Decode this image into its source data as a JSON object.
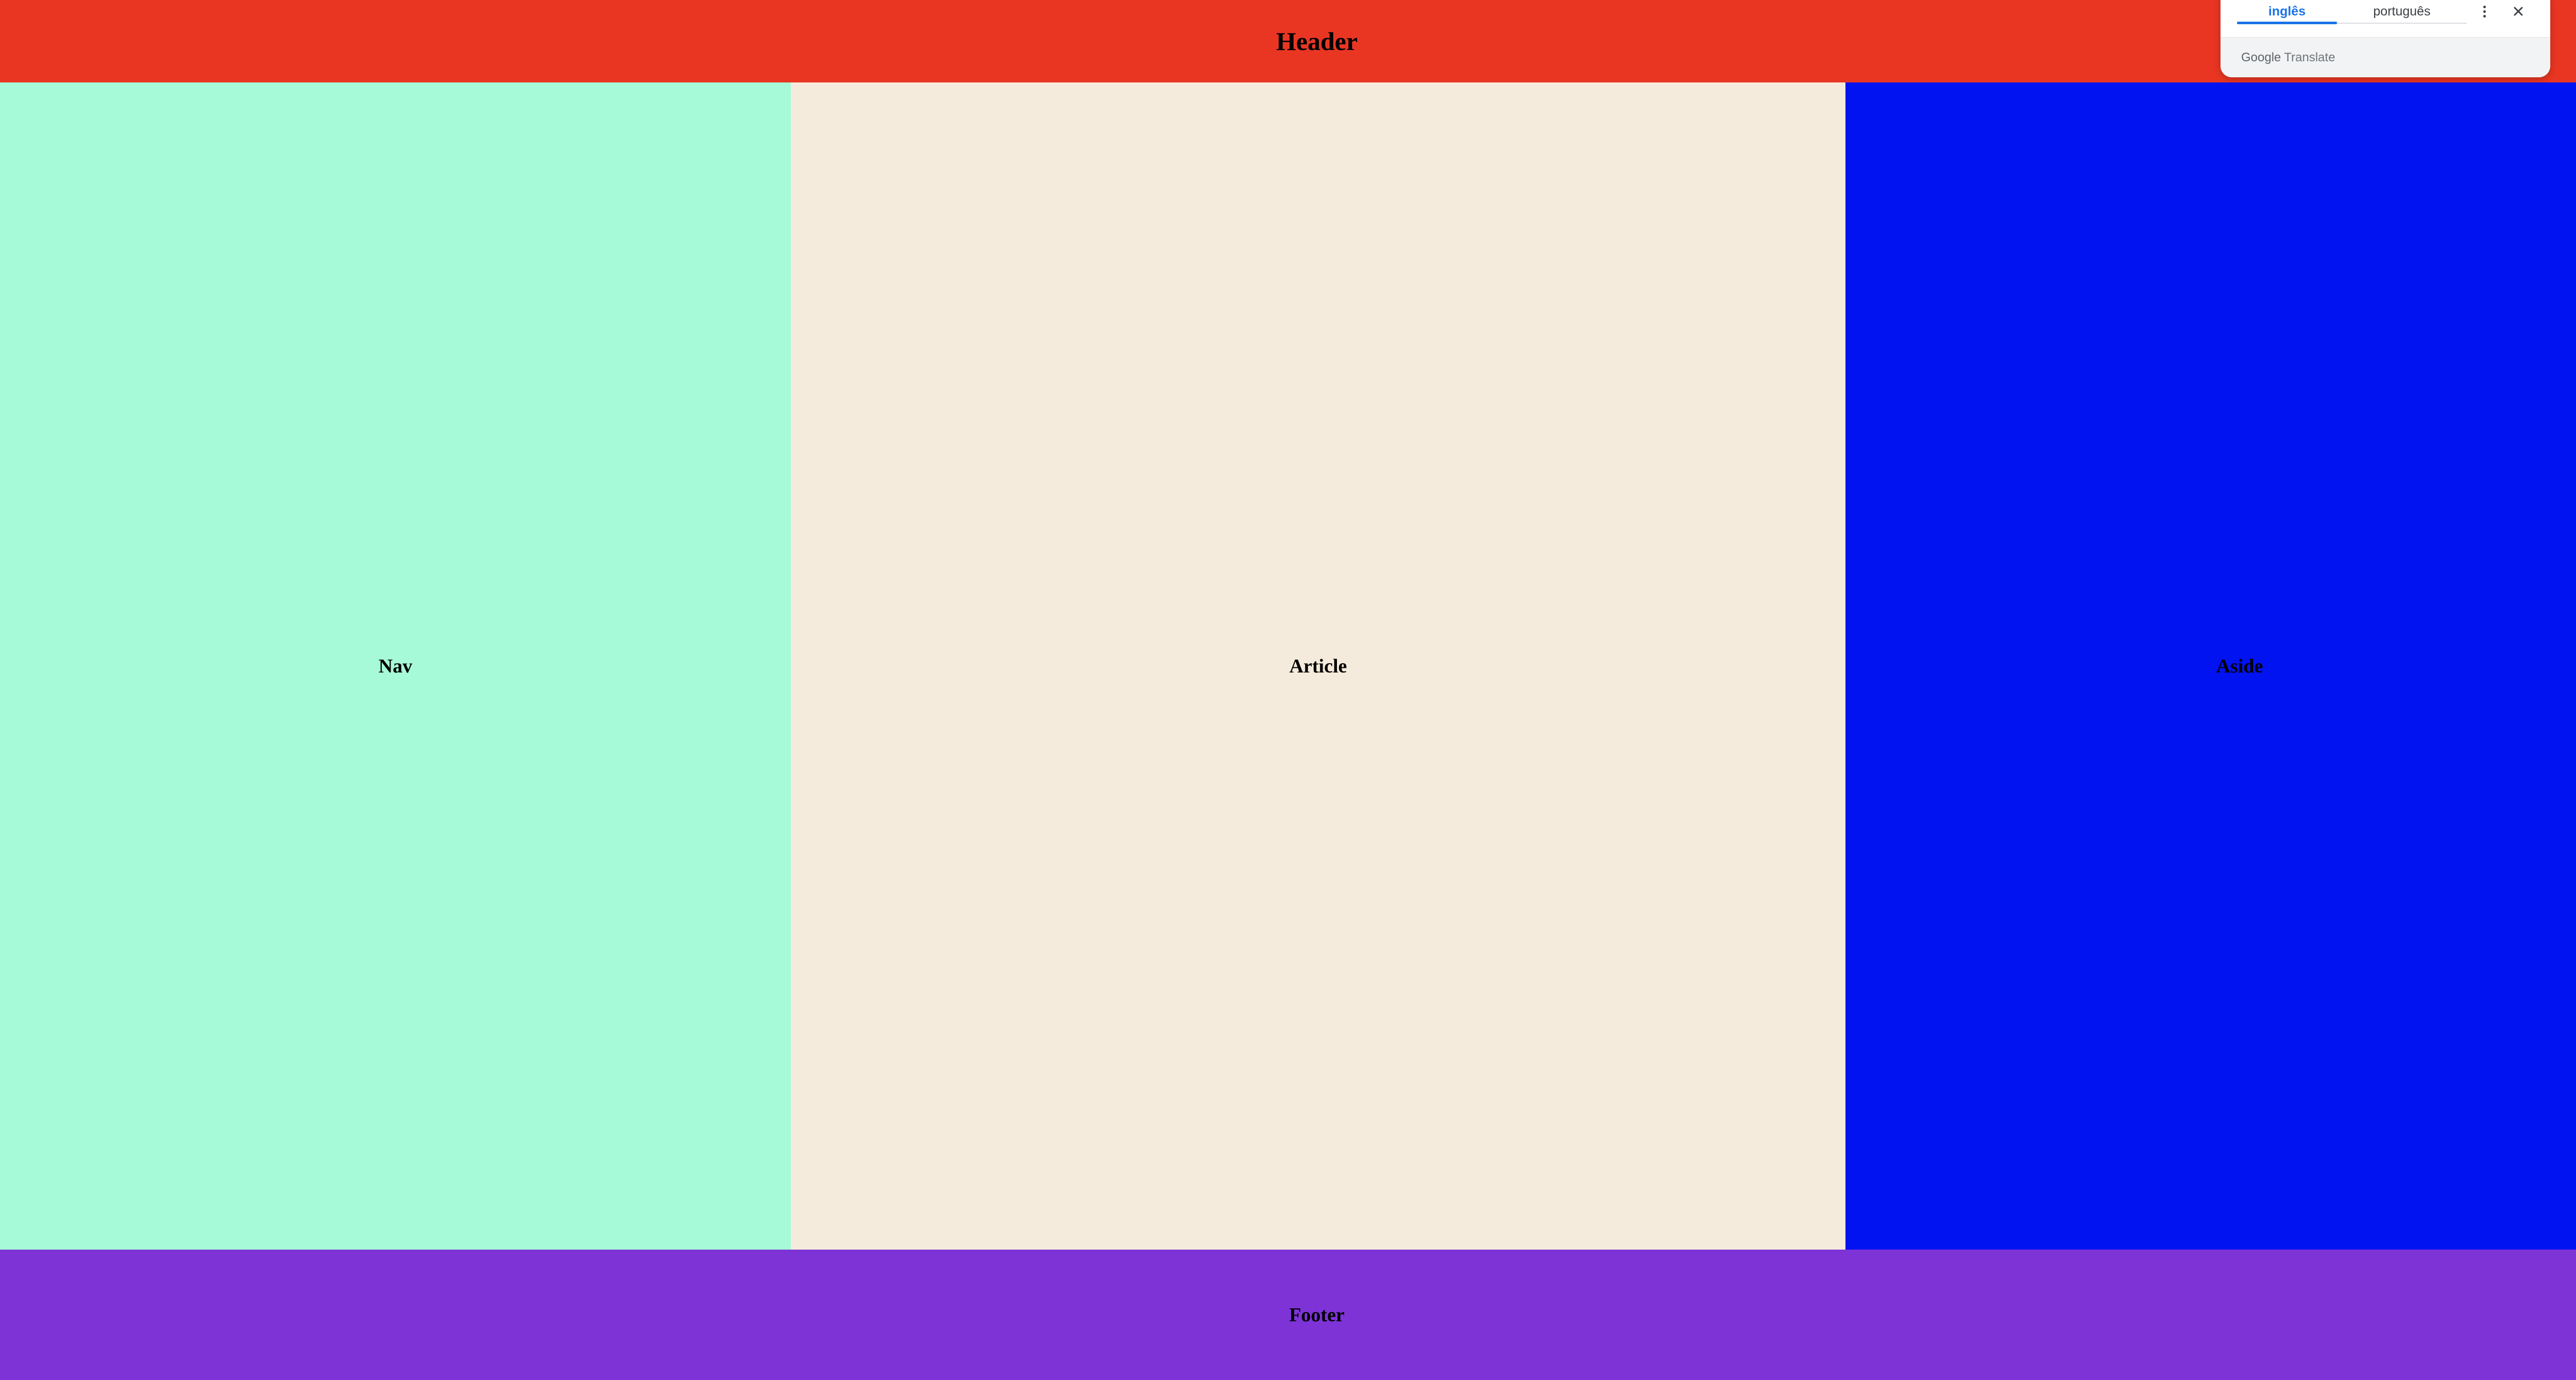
{
  "layout": {
    "header": {
      "label": "Header",
      "bg": "#e93623"
    },
    "nav": {
      "label": "Nav",
      "bg": "#a7fad7"
    },
    "article": {
      "label": "Article",
      "bg": "#f5ebdc"
    },
    "aside": {
      "label": "Aside",
      "bg": "#0113f1"
    },
    "footer": {
      "label": "Footer",
      "bg": "#7e33d7"
    }
  },
  "translate_popup": {
    "tabs": [
      {
        "label": "inglês",
        "active": true
      },
      {
        "label": "português",
        "active": false
      }
    ],
    "more_icon": "more-vert-icon",
    "close_icon": "close-icon",
    "brand": {
      "google": "Google",
      "translate": "Translate"
    },
    "accent_color": "#1a73e8"
  }
}
